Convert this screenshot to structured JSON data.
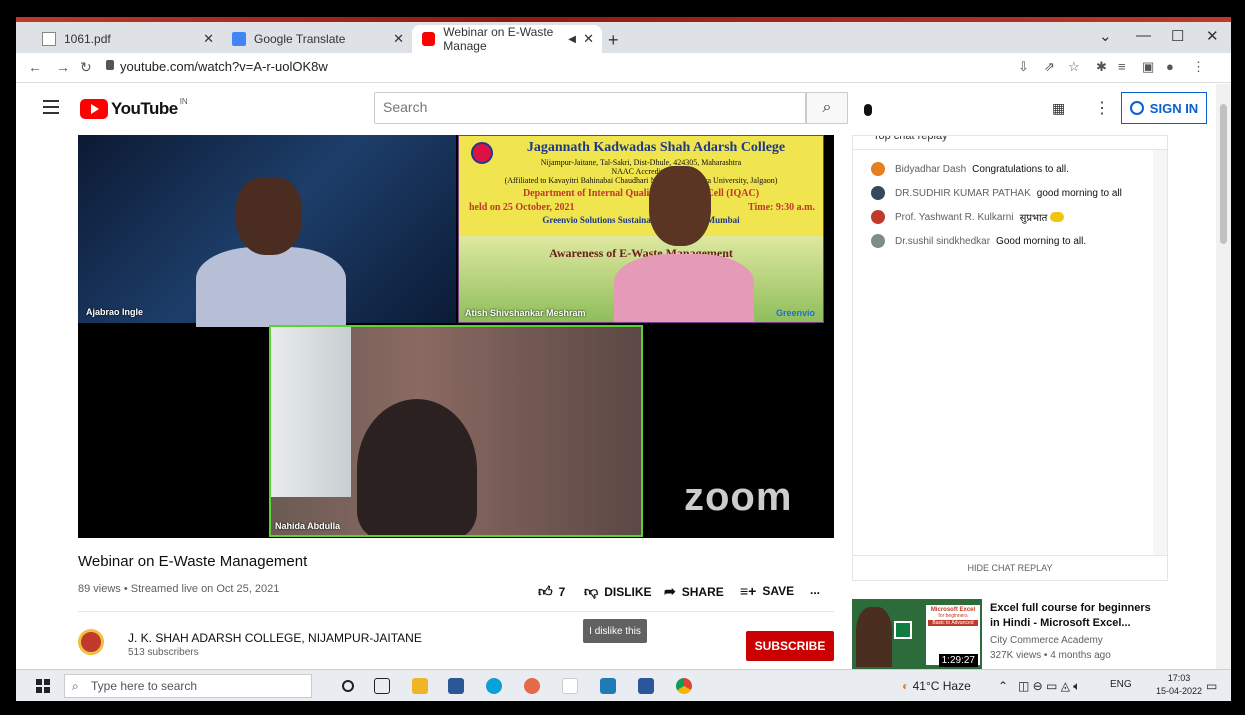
{
  "browser": {
    "tabs": [
      {
        "label": "1061.pdf"
      },
      {
        "label": "Google Translate"
      },
      {
        "label": "Webinar on E-Waste Manage"
      }
    ],
    "url": "youtube.com/watch?v=A-r-uolOK8w"
  },
  "youtube": {
    "logo": "YouTube",
    "country": "IN",
    "search_placeholder": "Search",
    "signin_label": "SIGN IN"
  },
  "video": {
    "participants": [
      {
        "name": "Ajabrao Ingle"
      },
      {
        "name": "Atish Shivshankar Meshram"
      },
      {
        "name": "Nahida Abdulla"
      }
    ],
    "watermark": "zoom",
    "slide": {
      "college": "Jagannath Kadwadas Shah Adarsh College",
      "address": "Nijampur-Jaitane, Tal-Sakri, Dist-Dhule, 424305, Maharashtra",
      "accreditation": "NAAC Accredited",
      "affiliation": "(Affiliated to Kavayitri Bahinabai Chaudhari North Maharashtra University, Jalgaon)",
      "department": "Department of Internal Quality Assurance Cell (IQAC)",
      "date": "held on 25 October, 2021",
      "time": "Time: 9:30 a.m.",
      "collab": "Greenvio Solutions Sustainability Partner, Mumbai",
      "topic": "Awareness of E-Waste Management",
      "brand": "Greenvio"
    }
  },
  "info": {
    "title": "Webinar on E-Waste Management",
    "meta": "89 views • Streamed live on Oct 25, 2021",
    "likes": "7",
    "dislike_label": "DISLIKE",
    "share_label": "SHARE",
    "save_label": "SAVE",
    "more_label": "...",
    "tooltip": "I dislike this",
    "channel_name": "J. K. SHAH ADARSH COLLEGE, NIJAMPUR-JAITANE",
    "channel_subs": "513 subscribers",
    "subscribe_label": "SUBSCRIBE"
  },
  "chat": {
    "header": "Top chat replay",
    "messages": [
      {
        "author": "Bidyadhar Dash",
        "text": "Congratulations to all.",
        "color": "#e67e22"
      },
      {
        "author": "DR.SUDHIR KUMAR PATHAK",
        "text": "good morning to all",
        "color": "#34495e"
      },
      {
        "author": "Prof. Yashwant R. Kulkarni",
        "text": "सुप्रभात",
        "color": "#c0392b"
      },
      {
        "author": "Dr.sushil sindkhedkar",
        "text": "Good morning to all.",
        "color": "#7f8c8d"
      }
    ],
    "hide_label": "HIDE CHAT REPLAY"
  },
  "recommendation": {
    "title": "Excel full course for beginners in Hindi - Microsoft Excel...",
    "channel": "City Commerce Academy",
    "meta": "327K views • 4 months ago",
    "duration": "1:29:27",
    "thumb_label": "Microsoft Excel",
    "thumb_sub": "for beginners",
    "thumb_badge": "Basic to Advanced"
  },
  "taskbar": {
    "search_placeholder": "Type here to search",
    "weather": "41°C Haze",
    "lang": "ENG",
    "time": "17:03",
    "date": "15-04-2022"
  }
}
